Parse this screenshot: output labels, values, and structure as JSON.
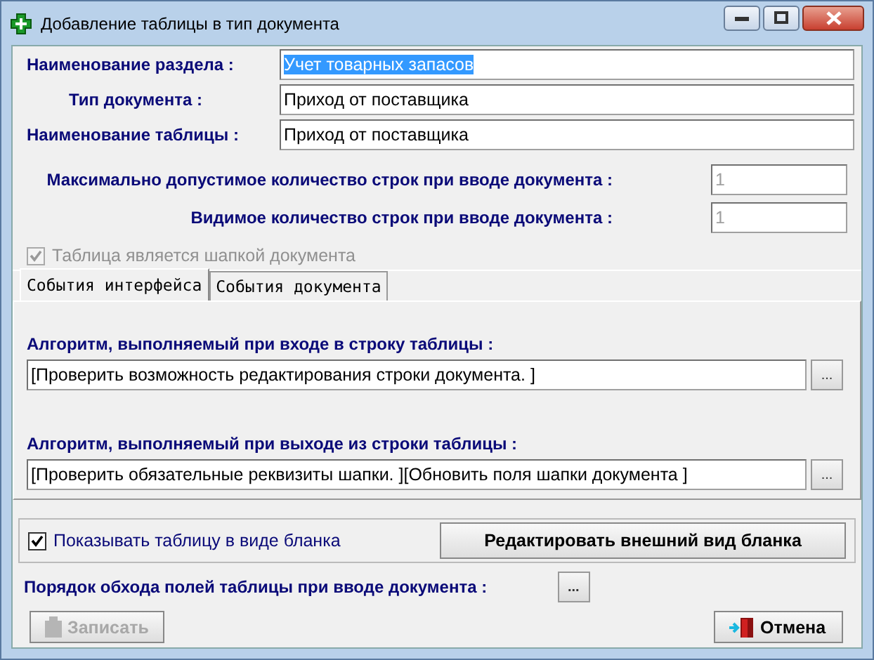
{
  "window": {
    "title": "Добавление таблицы в тип документа"
  },
  "fields": [
    {
      "label": "Наименование раздела :",
      "value": "Учет товарных запасов",
      "selected": true
    },
    {
      "label": "Тип документа :",
      "value": "Приход от поставщика",
      "selected": false
    },
    {
      "label": "Наименование таблицы :",
      "value": "Приход от поставщика",
      "selected": false
    }
  ],
  "limits": [
    {
      "label": "Максимально допустимое количество строк при вводе документа :",
      "value": "1",
      "disabled": true
    },
    {
      "label": "Видимое количество строк при вводе документа :",
      "value": "1",
      "disabled": true
    }
  ],
  "header_checkbox": {
    "label": "Таблица является шапкой документа",
    "checked": true,
    "disabled": true
  },
  "tabs": [
    {
      "label": "События интерфейса",
      "selected": true
    },
    {
      "label": "События документа",
      "selected": false
    }
  ],
  "algorithms": [
    {
      "label": "Алгоритм, выполняемый при входе в строку таблицы :",
      "value": "[Проверить возможность редактирования  строки документа. ]",
      "button": "..."
    },
    {
      "label": "Алгоритм, выполняемый при выходе из строки таблицы :",
      "value": "[Проверить обязательные реквизиты шапки. ][Обновить поля шапки документа  ]",
      "button": "..."
    }
  ],
  "show_form": {
    "label": "Показывать таблицу в виде бланка",
    "checked": true,
    "button": "Редактировать внешний вид бланка"
  },
  "traversal": {
    "label": "Порядок обхода полей таблицы при вводе документа :",
    "button": "..."
  },
  "buttons": [
    {
      "label": "Записать",
      "kind": "save",
      "disabled": true
    },
    {
      "label": "Отмена",
      "kind": "cancel",
      "disabled": false
    }
  ]
}
